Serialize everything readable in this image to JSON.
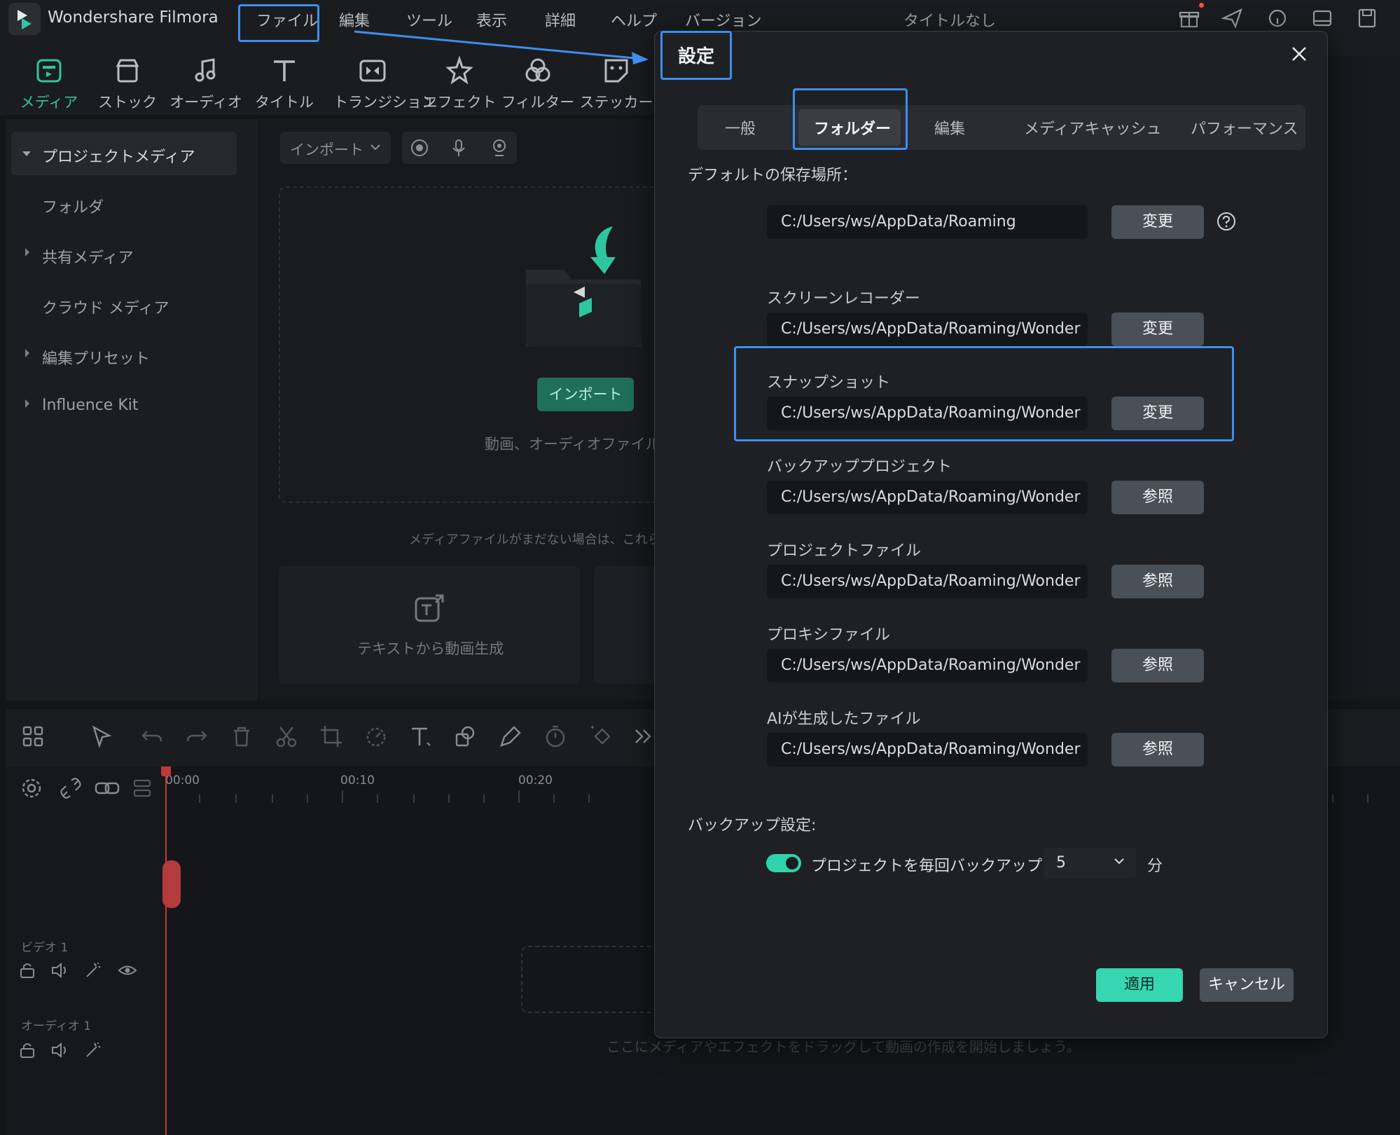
{
  "app": {
    "name": "Wondershare Filmora",
    "document_title": "タイトルなし",
    "menu": [
      "ファイル",
      "編集",
      "ツール",
      "表示",
      "詳細",
      "ヘルプ",
      "バージョン"
    ]
  },
  "tool_tabs": [
    {
      "label": "メディア",
      "icon": "media-icon"
    },
    {
      "label": "ストック",
      "icon": "stock-icon"
    },
    {
      "label": "オーディオ",
      "icon": "music-note-icon"
    },
    {
      "label": "タイトル",
      "icon": "title-t-icon"
    },
    {
      "label": "トランジション",
      "icon": "transition-icon"
    },
    {
      "label": "エフェクト",
      "icon": "effect-star-icon"
    },
    {
      "label": "フィルター",
      "icon": "filter-icon"
    },
    {
      "label": "ステッカー",
      "icon": "sticker-icon"
    }
  ],
  "sidebar": {
    "items": [
      {
        "label": "プロジェクトメディア"
      },
      {
        "label": "フォルダ"
      },
      {
        "label": "共有メディア"
      },
      {
        "label": "クラウド メディア"
      },
      {
        "label": "編集プリセット"
      },
      {
        "label": "Influence Kit"
      }
    ]
  },
  "media": {
    "import_dropdown": "インポート",
    "import_button": "インポート",
    "drop_hint": "動画、オーディオファイル、",
    "no_media_hint": "メディアファイルがまだない場合は、これらのツ",
    "text_to_video": "テキストから動画生成"
  },
  "timeline": {
    "ruler": [
      "00:00",
      "00:10",
      "00:20"
    ],
    "tracks": [
      "ビデオ 1",
      "オーディオ 1"
    ],
    "hint": "ここにメディアやエフェクトをドラッグして動画の作成を開始しましょう。"
  },
  "dialog": {
    "title": "設定",
    "tabs": [
      "一般",
      "フォルダー",
      "編集",
      "メディアキャッシュ",
      "パフォーマンス"
    ],
    "default_save_label": "デフォルトの保存場所：",
    "default_path": "C:/Users/ws/AppData/Roaming",
    "change_label": "変更",
    "browse_label": "参照",
    "folders": [
      {
        "label": "スクリーンレコーダー",
        "path": "C:/Users/ws/AppData/Roaming/Wonder",
        "button": "変更"
      },
      {
        "label": "スナップショット",
        "path": "C:/Users/ws/AppData/Roaming/Wonder",
        "button": "変更"
      },
      {
        "label": "バックアッププロジェクト",
        "path": "C:/Users/ws/AppData/Roaming/Wonder",
        "button": "参照"
      },
      {
        "label": "プロジェクトファイル",
        "path": "C:/Users/ws/AppData/Roaming/Wonder",
        "button": "参照"
      },
      {
        "label": "プロキシファイル",
        "path": "C:/Users/ws/AppData/Roaming/Wonder",
        "button": "参照"
      },
      {
        "label": "AIが生成したファイル",
        "path": "C:/Users/ws/AppData/Roaming/Wonder",
        "button": "参照"
      }
    ],
    "backup_settings_label": "バックアップ設定:",
    "backup_toggle_label": "プロジェクトを毎回バックアップする",
    "backup_toggle_on": true,
    "backup_interval": "5",
    "backup_unit": "分",
    "apply": "適用",
    "cancel": "キャンセル"
  },
  "colors": {
    "accent": "#35d6b1",
    "highlight": "#3d8ef0",
    "dialog_bg": "#1e2024"
  }
}
